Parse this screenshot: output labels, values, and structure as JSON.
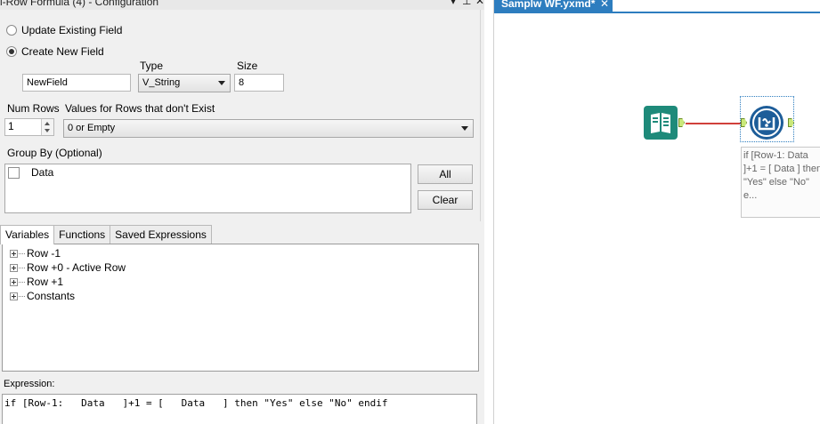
{
  "panel": {
    "title": "i-Row Formula (4) - Configuration",
    "icons": [
      "dropdown-arrow-icon",
      "pin-icon",
      "close-icon"
    ],
    "icon_glyphs": [
      "▾",
      "⊥",
      "✕"
    ]
  },
  "config": {
    "update_existing_label": "Update Existing Field",
    "create_new_label": "Create New  Field",
    "new_field_value": "NewField",
    "type_label": "Type",
    "type_value": "V_String",
    "size_label": "Size",
    "size_value": "8",
    "num_rows_label": "Num Rows",
    "num_rows_value": "1",
    "values_rows_label": "Values for Rows that don't Exist",
    "values_rows_value": "0 or Empty",
    "group_by_label": "Group By (Optional)",
    "group_by_items": [
      {
        "label": "Data",
        "checked": false
      }
    ],
    "all_button": "All",
    "clear_button": "Clear"
  },
  "tabs": [
    {
      "label": "Variables",
      "active": true
    },
    {
      "label": "Functions",
      "active": false
    },
    {
      "label": "Saved Expressions",
      "active": false
    }
  ],
  "variables": [
    "Row -1",
    "Row +0 - Active Row",
    "Row +1",
    "Constants"
  ],
  "expression": {
    "label": "Expression:",
    "text": "if [Row-1:   Data   ]+1 = [   Data   ] then \"Yes\" else \"No\" endif"
  },
  "canvas": {
    "tab_label": "Samplw WF.yxmd*",
    "tab_close": "✕",
    "annotation": "if [Row-1:   Data   ]+1 = [   Data   ] then \"Yes\" else \"No\" e..."
  },
  "colors": {
    "accent": "#2d7dbf",
    "input_tool": "#1e8a7a",
    "mrf_tool": "#1d5d99",
    "connection": "#d0403a",
    "anchor": "#c9e87a"
  }
}
